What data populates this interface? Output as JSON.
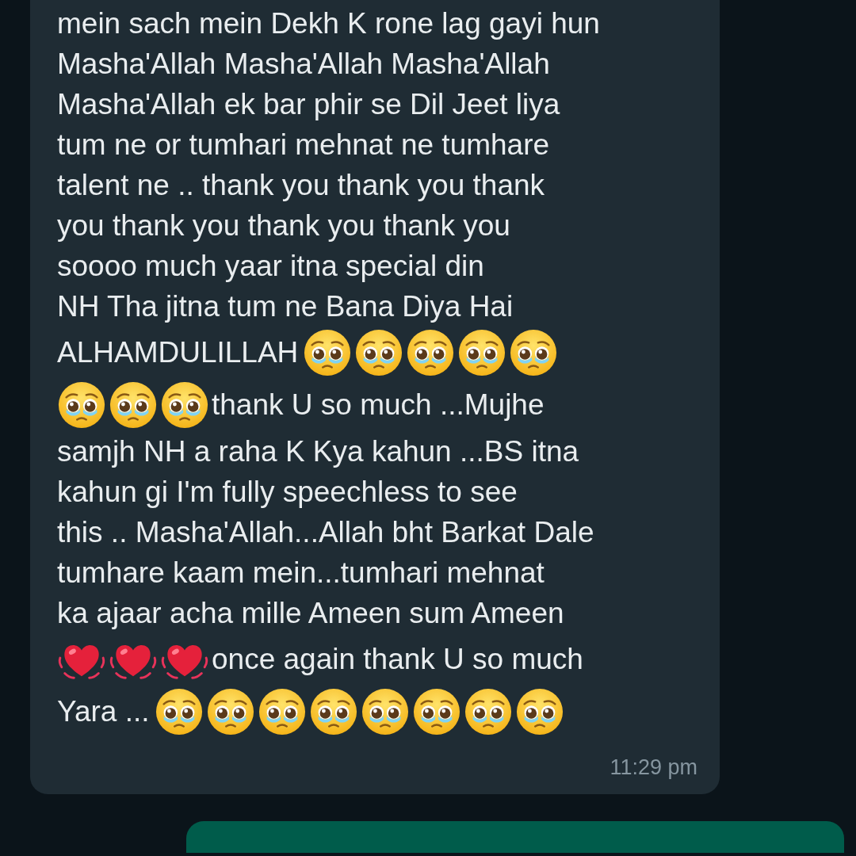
{
  "message": {
    "lines": [
      [
        {
          "kind": "text",
          "text": "mein sach mein Dekh K rone lag gayi hun"
        }
      ],
      [
        {
          "kind": "text",
          "text": "Masha'Allah Masha'Allah Masha'Allah"
        }
      ],
      [
        {
          "kind": "text",
          "text": "Masha'Allah ek bar phir se Dil Jeet liya"
        }
      ],
      [
        {
          "kind": "text",
          "text": "tum ne or tumhari mehnat ne tumhare"
        }
      ],
      [
        {
          "kind": "text",
          "text": "talent ne .. thank you thank you thank"
        }
      ],
      [
        {
          "kind": "text",
          "text": "you thank you thank you thank you"
        }
      ],
      [
        {
          "kind": "text",
          "text": "soooo much yaar itna special din"
        }
      ],
      [
        {
          "kind": "text",
          "text": "NH Tha jitna tum ne Bana Diya Hai"
        }
      ],
      [
        {
          "kind": "text",
          "text": "ALHAMDULILLAH"
        },
        {
          "kind": "teary-face"
        },
        {
          "kind": "teary-face"
        },
        {
          "kind": "teary-face"
        },
        {
          "kind": "teary-face"
        },
        {
          "kind": "teary-face"
        }
      ],
      [
        {
          "kind": "teary-face"
        },
        {
          "kind": "teary-face"
        },
        {
          "kind": "teary-face"
        },
        {
          "kind": "text",
          "text": "thank U so much ...Mujhe"
        }
      ],
      [
        {
          "kind": "text",
          "text": "samjh NH a raha K Kya kahun ...BS itna"
        }
      ],
      [
        {
          "kind": "text",
          "text": "kahun gi I'm fully speechless to see"
        }
      ],
      [
        {
          "kind": "text",
          "text": "this .. Masha'Allah...Allah bht Barkat Dale"
        }
      ],
      [
        {
          "kind": "text",
          "text": "tumhare kaam mein...tumhari mehnat"
        }
      ],
      [
        {
          "kind": "text",
          "text": "ka ajaar acha mille Ameen sum Ameen"
        }
      ],
      [
        {
          "kind": "heart"
        },
        {
          "kind": "heart"
        },
        {
          "kind": "heart"
        },
        {
          "kind": "text",
          "text": "once again thank U so much"
        }
      ],
      [
        {
          "kind": "text",
          "text": "Yara ..."
        },
        {
          "kind": "teary-face"
        },
        {
          "kind": "teary-face"
        },
        {
          "kind": "teary-face"
        },
        {
          "kind": "teary-face"
        },
        {
          "kind": "teary-face"
        },
        {
          "kind": "teary-face"
        },
        {
          "kind": "teary-face"
        },
        {
          "kind": "teary-face"
        }
      ]
    ],
    "time": "11:29 pm"
  }
}
